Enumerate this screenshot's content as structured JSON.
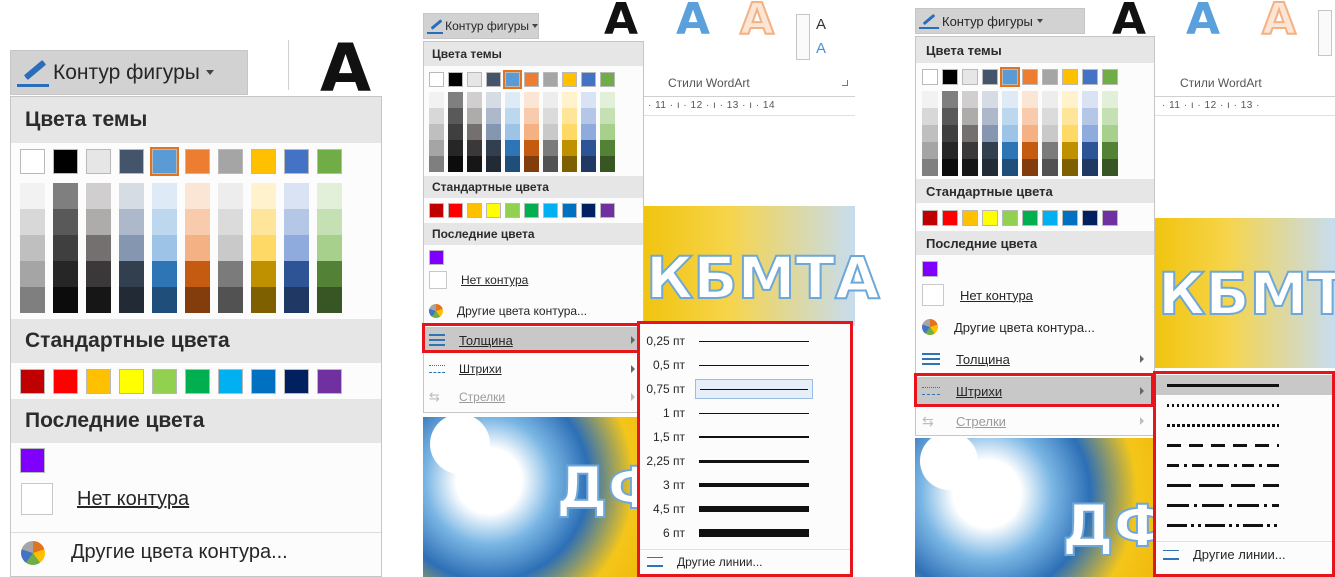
{
  "outline_button": {
    "label": "Контур фигуры"
  },
  "theme_colors_title": "Цвета темы",
  "standard_colors_title": "Стандартные цвета",
  "recent_colors_title": "Последние цвета",
  "no_outline": "Нет контура",
  "more_outline_colors": "Другие цвета контура...",
  "weight_label": "Толщина",
  "dashes_label": "Штрихи",
  "arrows_label": "Стрелки",
  "more_lines": "Другие линии...",
  "wordart_group": "Стили WordArt",
  "ruler_numbers": "· 11 · ı · 12 · ı · 13 · ı · 14",
  "ruler_numbers_right": "· 11 · ı · 12 · ı · 13 ·",
  "banner_text": "КБМТА",
  "banner_text_right": "КБМТ",
  "bottom_text": "ДФ",
  "wordart_letter": "A",
  "theme_colors": {
    "top": [
      "#ffffff",
      "#000000",
      "#e7e6e6",
      "#44546a",
      "#5b9bd5",
      "#ed7d31",
      "#a5a5a5",
      "#ffc000",
      "#4472c4",
      "#70ad47"
    ],
    "selected_index": 4,
    "shades": [
      [
        "#f2f2f2",
        "#d8d8d8",
        "#bfbfbf",
        "#a5a5a5",
        "#7f7f7f"
      ],
      [
        "#7f7f7f",
        "#595959",
        "#3f3f3f",
        "#262626",
        "#0c0c0c"
      ],
      [
        "#d0cece",
        "#aeabab",
        "#757070",
        "#3a3838",
        "#171616"
      ],
      [
        "#d6dce4",
        "#adb9ca",
        "#8496b0",
        "#323f4f",
        "#222a35"
      ],
      [
        "#deebf6",
        "#bdd7ee",
        "#9dc3e6",
        "#2e75b5",
        "#1e4e79"
      ],
      [
        "#fbe5d5",
        "#f7cbac",
        "#f4b183",
        "#c55a11",
        "#833c0b"
      ],
      [
        "#ededed",
        "#dbdbdb",
        "#c9c9c9",
        "#7b7b7b",
        "#525252"
      ],
      [
        "#fff2cc",
        "#fee599",
        "#ffd965",
        "#bf9000",
        "#7f6000"
      ],
      [
        "#dae3f3",
        "#b4c7e7",
        "#8faadc",
        "#2f5496",
        "#1f3864"
      ],
      [
        "#e2efd9",
        "#c5e0b3",
        "#a8d08d",
        "#538135",
        "#375623"
      ]
    ]
  },
  "standard_colors": [
    "#c00000",
    "#ff0000",
    "#ffc000",
    "#ffff00",
    "#92d050",
    "#00b050",
    "#00b0f0",
    "#0070c0",
    "#002060",
    "#7030a0"
  ],
  "recent_colors": [
    "#7f00ff"
  ],
  "weights": [
    {
      "label": "0,25 пт",
      "pt": 0.25
    },
    {
      "label": "0,5 пт",
      "pt": 0.5
    },
    {
      "label": "0,75 пт",
      "pt": 0.75,
      "selected": true
    },
    {
      "label": "1 пт",
      "pt": 1
    },
    {
      "label": "1,5 пт",
      "pt": 1.5
    },
    {
      "label": "2,25 пт",
      "pt": 2.25
    },
    {
      "label": "3 пт",
      "pt": 3
    },
    {
      "label": "4,5 пт",
      "pt": 4.5
    },
    {
      "label": "6 пт",
      "pt": 6
    }
  ],
  "dash_styles": [
    "solid",
    "round-dot",
    "square-dot",
    "dash",
    "dash-dot",
    "long-dash",
    "long-dash-dot",
    "long-dash-dot-dot"
  ],
  "colors": {
    "highlight_frame": "#e8141b",
    "menu_bg": "#fcfcfc",
    "section_bg": "#e6e6e6",
    "hover_bg": "#c8c8c8"
  }
}
